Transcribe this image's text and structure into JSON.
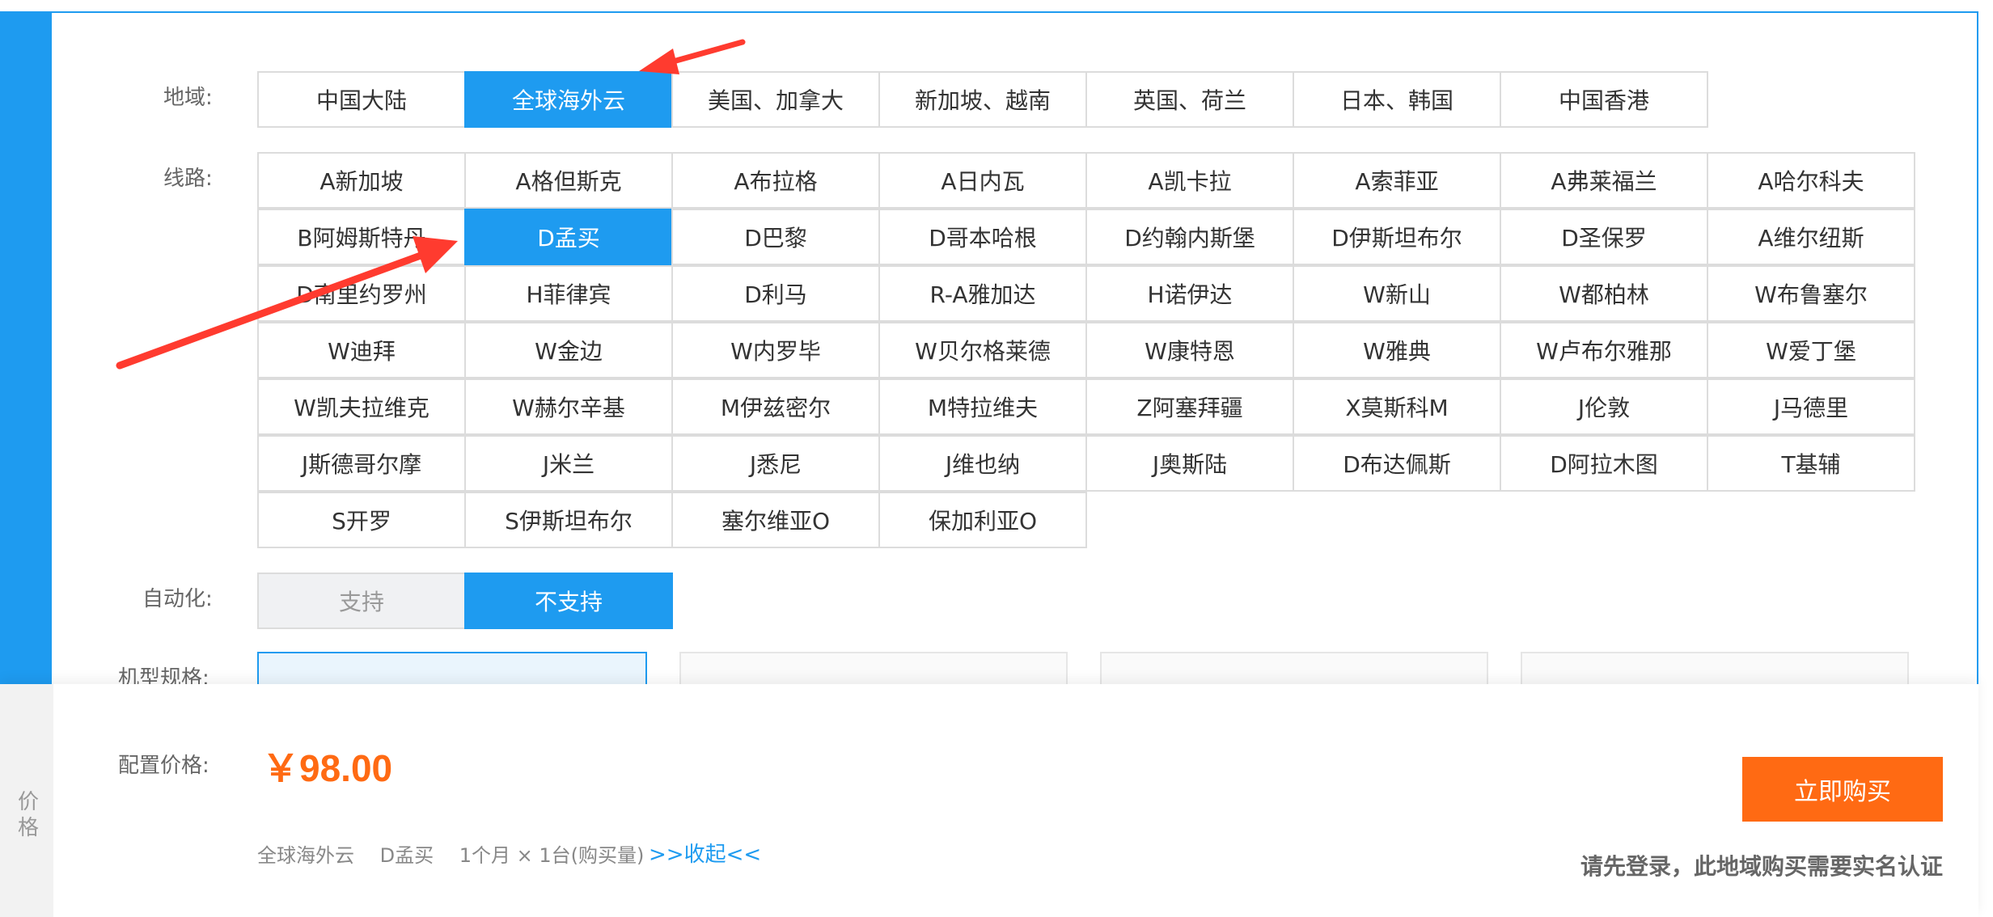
{
  "labels": {
    "region": "地域:",
    "line": "线路:",
    "automation": "自动化:",
    "spec": "机型规格:"
  },
  "region_tabs": [
    "中国大陆",
    "全球海外云",
    "美国、加拿大",
    "新加坡、越南",
    "英国、荷兰",
    "日本、韩国",
    "中国香港"
  ],
  "region_selected": "全球海外云",
  "line_tabs": [
    "A新加坡",
    "A格但斯克",
    "A布拉格",
    "A日内瓦",
    "A凯卡拉",
    "A索菲亚",
    "A弗莱福兰",
    "A哈尔科夫",
    "B阿姆斯特丹",
    "D孟买",
    "D巴黎",
    "D哥本哈根",
    "D约翰内斯堡",
    "D伊斯坦布尔",
    "D圣保罗",
    "A维尔纽斯",
    "D南里约罗州",
    "H菲律宾",
    "D利马",
    "R-A雅加达",
    "H诺伊达",
    "W新山",
    "W都柏林",
    "W布鲁塞尔",
    "W迪拜",
    "W金边",
    "W内罗毕",
    "W贝尔格莱德",
    "W康特恩",
    "W雅典",
    "W卢布尔雅那",
    "W爱丁堡",
    "W凯夫拉维克",
    "W赫尔辛基",
    "M伊兹密尔",
    "M特拉维夫",
    "Z阿塞拜疆",
    "X莫斯科M",
    "J伦敦",
    "J马德里",
    "J斯德哥尔摩",
    "J米兰",
    "J悉尼",
    "J维也纳",
    "J奥斯陆",
    "D布达佩斯",
    "D阿拉木图",
    "T基辅",
    "S开罗",
    "S伊斯坦布尔",
    "塞尔维亚O",
    "保加利亚O"
  ],
  "line_selected": "D孟买",
  "automation_tabs": [
    "支持",
    "不支持"
  ],
  "automation_selected": "不支持",
  "price": {
    "side_label": "价格",
    "label": "配置价格:",
    "value": "￥98.00",
    "summary": {
      "region": "全球海外云",
      "line": "D孟买",
      "duration": "1个月 × 1台(购买量)"
    },
    "toggle": ">>收起<<",
    "buy_button": "立即购买",
    "hint": "请先登录，此地域购买需要实名认证"
  },
  "colors": {
    "primary": "#1e9bf0",
    "price": "#ff6a13",
    "annotation_arrow": "#ff3b2f"
  }
}
